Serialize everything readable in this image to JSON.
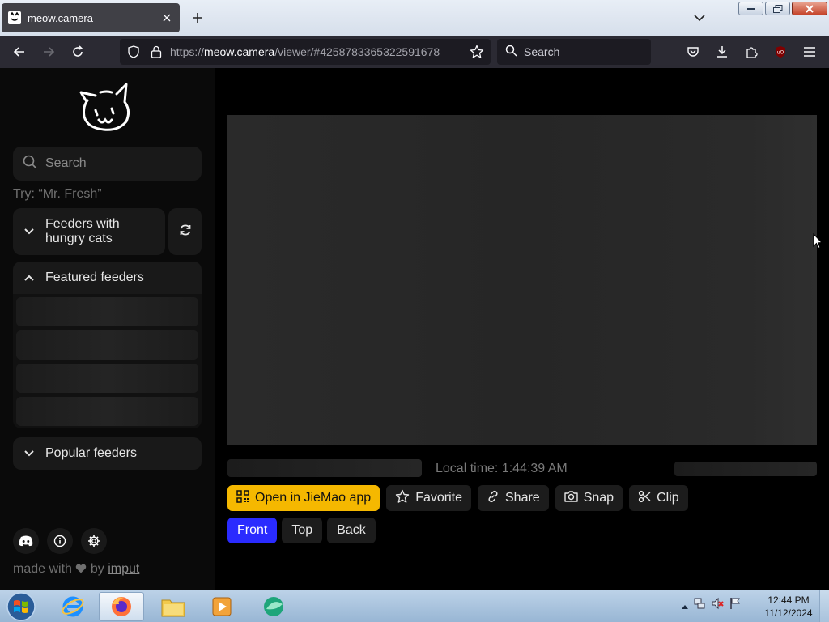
{
  "browser": {
    "tab_title": "meow.camera",
    "url_scheme": "https://",
    "url_host": "meow.camera",
    "url_path": "/viewer/#4258783365322591678",
    "search_placeholder": "Search"
  },
  "sidebar": {
    "search_placeholder": "Search",
    "try_hint": "Try: “Mr. Fresh”",
    "hungry_section": "Feeders with hungry cats",
    "featured_section": "Featured feeders",
    "popular_section": "Popular feeders",
    "footer_prefix": "made with",
    "footer_by": "by",
    "footer_link": "imput"
  },
  "viewer": {
    "local_time": "Local time: 1:44:39 AM",
    "actions": {
      "open_app": "Open in JieMao app",
      "favorite": "Favorite",
      "share": "Share",
      "snap": "Snap",
      "clip": "Clip"
    },
    "views": {
      "front": "Front",
      "top": "Top",
      "back": "Back",
      "selected": "Front"
    }
  },
  "taskbar": {
    "time": "12:44 PM",
    "date": "11/12/2024"
  },
  "colors": {
    "accent_yellow": "#f5b800",
    "accent_blue": "#2a2bff",
    "browser_chrome": "#2b2a33"
  }
}
